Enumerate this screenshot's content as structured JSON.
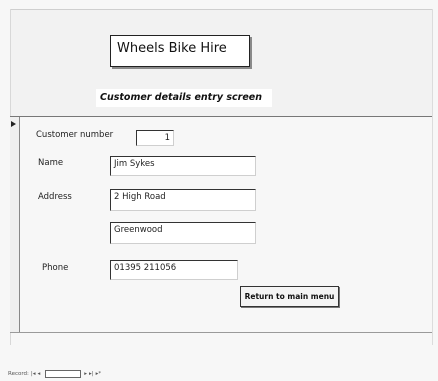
{
  "form": {
    "title": "Wheels Bike Hire",
    "subtitle": "Customer details entry screen"
  },
  "fields": {
    "customer_number_label": "Customer number",
    "customer_number_value": "1",
    "name_label": "Name",
    "name_value": "Jim Sykes",
    "address_label": "Address",
    "address_line1": "2 High Road",
    "address_line2": "Greenwood",
    "phone_label": "Phone",
    "phone_value": "01395 211056"
  },
  "buttons": {
    "return_label": "Return to main menu"
  },
  "navigation": {
    "record_label": "Record:",
    "first": "|◂",
    "prev": "◂",
    "next": "▸",
    "last": "▸|",
    "new": "▸*"
  }
}
